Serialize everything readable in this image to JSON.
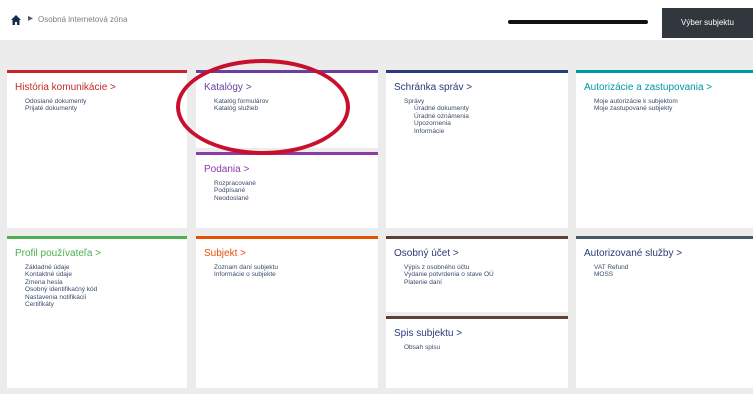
{
  "header": {
    "breadcrumb": "Osobná internetová zóna",
    "pick_subject": "Výber subjektu"
  },
  "cards": {
    "history": {
      "title": "História komunikácie >",
      "links": [
        "Odoslané dokumenty",
        "Prijaté dokumenty"
      ],
      "color": "#c62828"
    },
    "catalogs": {
      "title": "Katalógy >",
      "links": [
        "Katalóg formulárov",
        "Katalóg služieb"
      ],
      "color": "#6a3fa0"
    },
    "mailbox": {
      "title": "Schránka správ >",
      "links": [
        "Správy",
        "Úradné dokumenty",
        "Úradné oznámenia",
        "Upozornenia",
        "Informácie"
      ],
      "color": "#2a3a7a"
    },
    "authorization": {
      "title": "Autorizácie a zastupovania >",
      "links": [
        "Moje autorizácie k subjektom",
        "Moje zastupované subjekty"
      ],
      "color": "#0097a7"
    },
    "submissions": {
      "title": "Podania >",
      "links": [
        "Rozpracované",
        "Podpísané",
        "Neodoslané"
      ],
      "color": "#8e3aa7"
    },
    "profile": {
      "title": "Profil používateľa >",
      "links": [
        "Základné údaje",
        "Kontaktné údaje",
        "Zmena hesla",
        "Osobný identifikačný kód",
        "Nastavenia notifikácií",
        "Certifikáty"
      ],
      "color": "#4caf50"
    },
    "subject": {
      "title": "Subjekt >",
      "links": [
        "Zoznam daní subjektu",
        "Informácie o subjekte"
      ],
      "color": "#e65100"
    },
    "account": {
      "title": "Osobný účet >",
      "links": [
        "Výpis z osobného účtu",
        "Vydanie potvrdenia o stave OÚ",
        "Platenie daní"
      ],
      "color": "#5d4037"
    },
    "file": {
      "title": "Spis subjektu >",
      "links": [
        "Obsah spisu"
      ],
      "color": "#37474f"
    },
    "services": {
      "title": "Autorizované služby >",
      "links": [
        "VAT Refund",
        "MOSS"
      ],
      "color": "#455a64"
    }
  }
}
